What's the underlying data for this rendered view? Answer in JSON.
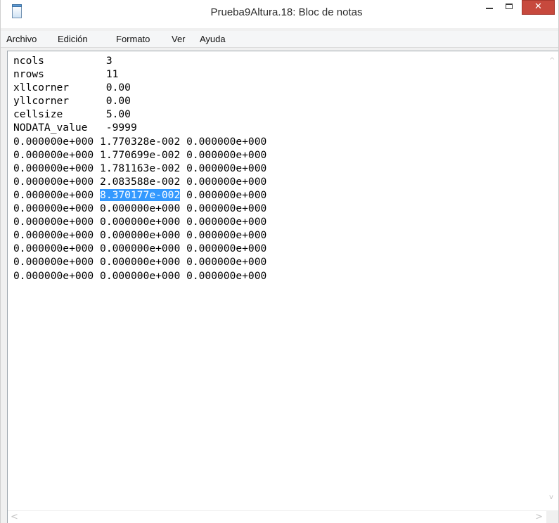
{
  "window": {
    "title": "Prueba9Altura.18: Bloc de notas",
    "icon": "notepad-icon",
    "controls": {
      "minimize_icon": "minimize-icon",
      "maximize_icon": "maximize-icon",
      "close_label": "✕"
    },
    "close_color": "#c7493d"
  },
  "menu": [
    {
      "label": "Archivo"
    },
    {
      "label": "Edición"
    },
    {
      "label": "Formato"
    },
    {
      "label": "Ver"
    },
    {
      "label": "Ayuda"
    }
  ],
  "document": {
    "header": [
      {
        "key": "ncols",
        "value": "3"
      },
      {
        "key": "nrows",
        "value": "11"
      },
      {
        "key": "xllcorner",
        "value": "0.00"
      },
      {
        "key": "yllcorner",
        "value": "0.00"
      },
      {
        "key": "cellsize",
        "value": "5.00"
      },
      {
        "key": "NODATA_value",
        "value": "-9999"
      }
    ],
    "grid": [
      [
        "0.000000e+000",
        "1.770328e-002",
        "0.000000e+000"
      ],
      [
        "0.000000e+000",
        "1.770699e-002",
        "0.000000e+000"
      ],
      [
        "0.000000e+000",
        "1.781163e-002",
        "0.000000e+000"
      ],
      [
        "0.000000e+000",
        "2.083588e-002",
        "0.000000e+000"
      ],
      [
        "0.000000e+000",
        "8.370177e-002",
        "0.000000e+000"
      ],
      [
        "0.000000e+000",
        "0.000000e+000",
        "0.000000e+000"
      ],
      [
        "0.000000e+000",
        "0.000000e+000",
        "0.000000e+000"
      ],
      [
        "0.000000e+000",
        "0.000000e+000",
        "0.000000e+000"
      ],
      [
        "0.000000e+000",
        "0.000000e+000",
        "0.000000e+000"
      ],
      [
        "0.000000e+000",
        "0.000000e+000",
        "0.000000e+000"
      ],
      [
        "0.000000e+000",
        "0.000000e+000",
        "0.000000e+000"
      ]
    ],
    "selection": {
      "row": 4,
      "col": 1
    },
    "selection_color": "#3399ff"
  }
}
